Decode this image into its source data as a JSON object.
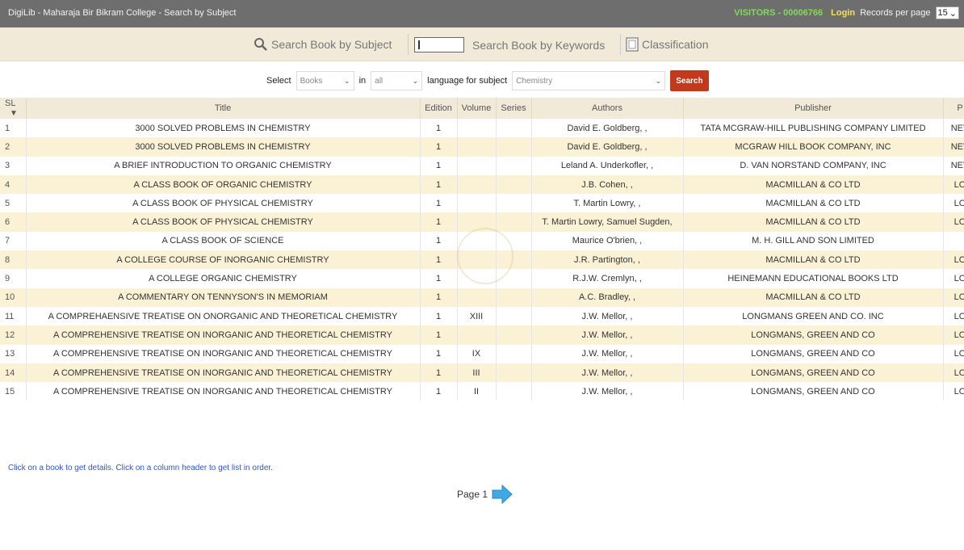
{
  "titlebar": {
    "title": "DigiLib - Maharaja Bir Bikram College - Search by Subject",
    "visitors": "VISITORS - 00006766",
    "login": "Login",
    "records_label": "Records per page",
    "records_value": "15"
  },
  "nav": {
    "subject": "Search Book by Subject",
    "keywords": "Search Book by Keywords",
    "classification": "Classification"
  },
  "filter": {
    "select_label": "Select",
    "type_value": "Books",
    "in_label": "in",
    "scope_value": "all",
    "lang_label": "language for subject",
    "subject_value": "Chemistry",
    "search_label": "Search"
  },
  "table": {
    "headers": {
      "sl": "SL",
      "title": "Title",
      "edition": "Edition",
      "volume": "Volume",
      "series": "Series",
      "authors": "Authors",
      "publisher": "Publisher",
      "place": "P"
    },
    "rows": [
      {
        "sl": "1",
        "title": "3000 SOLVED PROBLEMS IN CHEMISTRY",
        "edition": "1",
        "volume": "",
        "series": "",
        "authors": "David E. Goldberg, ,",
        "publisher": "TATA MCGRAW-HILL PUBLISHING COMPANY LIMITED",
        "place": "NEV"
      },
      {
        "sl": "2",
        "title": "3000 SOLVED PROBLEMS IN CHEMISTRY",
        "edition": "1",
        "volume": "",
        "series": "",
        "authors": "David E. Goldberg, ,",
        "publisher": "MCGRAW HILL BOOK COMPANY, INC",
        "place": "NEV"
      },
      {
        "sl": "3",
        "title": "A BRIEF INTRODUCTION TO ORGANIC CHEMISTRY",
        "edition": "1",
        "volume": "",
        "series": "",
        "authors": "Leland A. Underkofler, ,",
        "publisher": "D. VAN NORSTAND COMPANY, INC",
        "place": "NEV"
      },
      {
        "sl": "4",
        "title": "A CLASS BOOK OF ORGANIC CHEMISTRY",
        "edition": "1",
        "volume": "",
        "series": "",
        "authors": "J.B. Cohen, ,",
        "publisher": "MACMILLAN & CO LTD",
        "place": "LO"
      },
      {
        "sl": "5",
        "title": "A CLASS BOOK OF PHYSICAL CHEMISTRY",
        "edition": "1",
        "volume": "",
        "series": "",
        "authors": "T. Martin Lowry, ,",
        "publisher": "MACMILLAN & CO LTD",
        "place": "LO"
      },
      {
        "sl": "6",
        "title": "A CLASS BOOK OF PHYSICAL CHEMISTRY",
        "edition": "1",
        "volume": "",
        "series": "",
        "authors": "T. Martin Lowry, Samuel Sugden,",
        "publisher": "MACMILLAN & CO LTD",
        "place": "LO"
      },
      {
        "sl": "7",
        "title": "A CLASS BOOK OF SCIENCE",
        "edition": "1",
        "volume": "",
        "series": "",
        "authors": "Maurice O'brien, ,",
        "publisher": "M. H. GILL AND SON LIMITED",
        "place": ""
      },
      {
        "sl": "8",
        "title": "A COLLEGE COURSE OF INORGANIC CHEMISTRY",
        "edition": "1",
        "volume": "",
        "series": "",
        "authors": "J.R. Partington, ,",
        "publisher": "MACMILLAN & CO LTD",
        "place": "LO"
      },
      {
        "sl": "9",
        "title": "A COLLEGE ORGANIC CHEMISTRY",
        "edition": "1",
        "volume": "",
        "series": "",
        "authors": "R.J.W. Cremlyn, ,",
        "publisher": "HEINEMANN EDUCATIONAL BOOKS LTD",
        "place": "LO"
      },
      {
        "sl": "10",
        "title": "A COMMENTARY ON TENNYSON'S IN MEMORIAM",
        "edition": "1",
        "volume": "",
        "series": "",
        "authors": "A.C. Bradley, ,",
        "publisher": "MACMILLAN & CO LTD",
        "place": "LO"
      },
      {
        "sl": "11",
        "title": "A COMPREHAENSIVE TREATISE ON ONORGANIC AND THEORETICAL CHEMISTRY",
        "edition": "1",
        "volume": "XIII",
        "series": "",
        "authors": "J.W. Mellor, ,",
        "publisher": "LONGMANS GREEN AND CO. INC",
        "place": "LO"
      },
      {
        "sl": "12",
        "title": "A COMPREHENSIVE TREATISE ON INORGANIC AND THEORETICAL CHEMISTRY",
        "edition": "1",
        "volume": "",
        "series": "",
        "authors": "J.W. Mellor, ,",
        "publisher": "LONGMANS, GREEN AND CO",
        "place": "LO"
      },
      {
        "sl": "13",
        "title": "A COMPREHENSIVE TREATISE ON INORGANIC AND THEORETICAL CHEMISTRY",
        "edition": "1",
        "volume": "IX",
        "series": "",
        "authors": "J.W. Mellor, ,",
        "publisher": "LONGMANS, GREEN AND CO",
        "place": "LO"
      },
      {
        "sl": "14",
        "title": "A COMPREHENSIVE TREATISE ON INORGANIC AND THEORETICAL CHEMISTRY",
        "edition": "1",
        "volume": "III",
        "series": "",
        "authors": "J.W. Mellor, ,",
        "publisher": "LONGMANS, GREEN AND CO",
        "place": "LO"
      },
      {
        "sl": "15",
        "title": "A COMPREHENSIVE TREATISE ON INORGANIC AND THEORETICAL CHEMISTRY",
        "edition": "1",
        "volume": "II",
        "series": "",
        "authors": "J.W. Mellor, ,",
        "publisher": "LONGMANS, GREEN AND CO",
        "place": "LO"
      }
    ]
  },
  "footer": {
    "hint": "Click on a book to get details. Click on a column header to get list in order.",
    "page_label": "Page 1"
  },
  "colors": {
    "titlebar": "#6e6e6e",
    "accent_band": "#f1ead8",
    "row_alt": "#fbf2d6",
    "search_button": "#c2391c",
    "visitors": "#7fdc5a",
    "login": "#f5e05a",
    "link": "#3355cc"
  }
}
